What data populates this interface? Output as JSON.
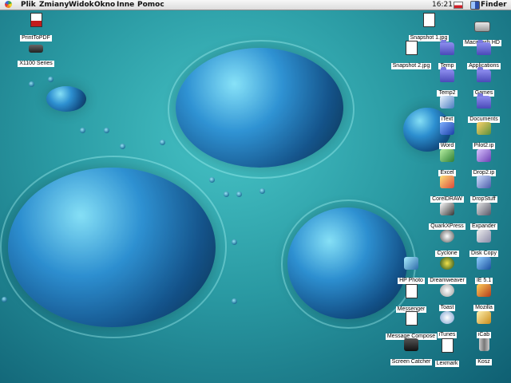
{
  "menubar": {
    "items": [
      "Plik",
      "Zmiany",
      "Widok",
      "Okno",
      "Inne",
      "Pomoc"
    ],
    "clock": "16:21",
    "app_name": "Finder"
  },
  "desktop": {
    "icons_left": [
      {
        "label": "PrintToPDF"
      },
      {
        "label": "X1100 Series"
      }
    ],
    "icons_right": [
      {
        "label": "Snapshot 1.jpg"
      },
      {
        "label": "Macintosh HD"
      },
      {
        "label": "Snapshot 2.jpg"
      },
      {
        "label": "Temp"
      },
      {
        "label": "Applications"
      },
      {
        "label": "Temp2"
      },
      {
        "label": "Games"
      },
      {
        "label": "iText"
      },
      {
        "label": "Documents"
      },
      {
        "label": "Word"
      },
      {
        "label": "Pilot2.ip"
      },
      {
        "label": "Excel"
      },
      {
        "label": "Drop2.ip"
      },
      {
        "label": "CorelDRAW"
      },
      {
        "label": "DropStuff"
      },
      {
        "label": "QuarkXPress"
      },
      {
        "label": "Expander"
      },
      {
        "label": "Cyclone"
      },
      {
        "label": "Disk Copy"
      },
      {
        "label": "HP Photo"
      },
      {
        "label": "Dreamweaver"
      },
      {
        "label": "IE 5.1"
      },
      {
        "label": "Messenger"
      },
      {
        "label": "Toast"
      },
      {
        "label": "Mozilla"
      },
      {
        "label": "Message Compose"
      },
      {
        "label": "iTunes"
      },
      {
        "label": "iCab"
      },
      {
        "label": "Screen Catcher"
      },
      {
        "label": "Lexmark"
      },
      {
        "label": "Kosz"
      }
    ]
  },
  "colors": {
    "desktop_base": "#2a9aa3",
    "folder": "#6b6bd8",
    "label_bg": "#ffffff"
  }
}
